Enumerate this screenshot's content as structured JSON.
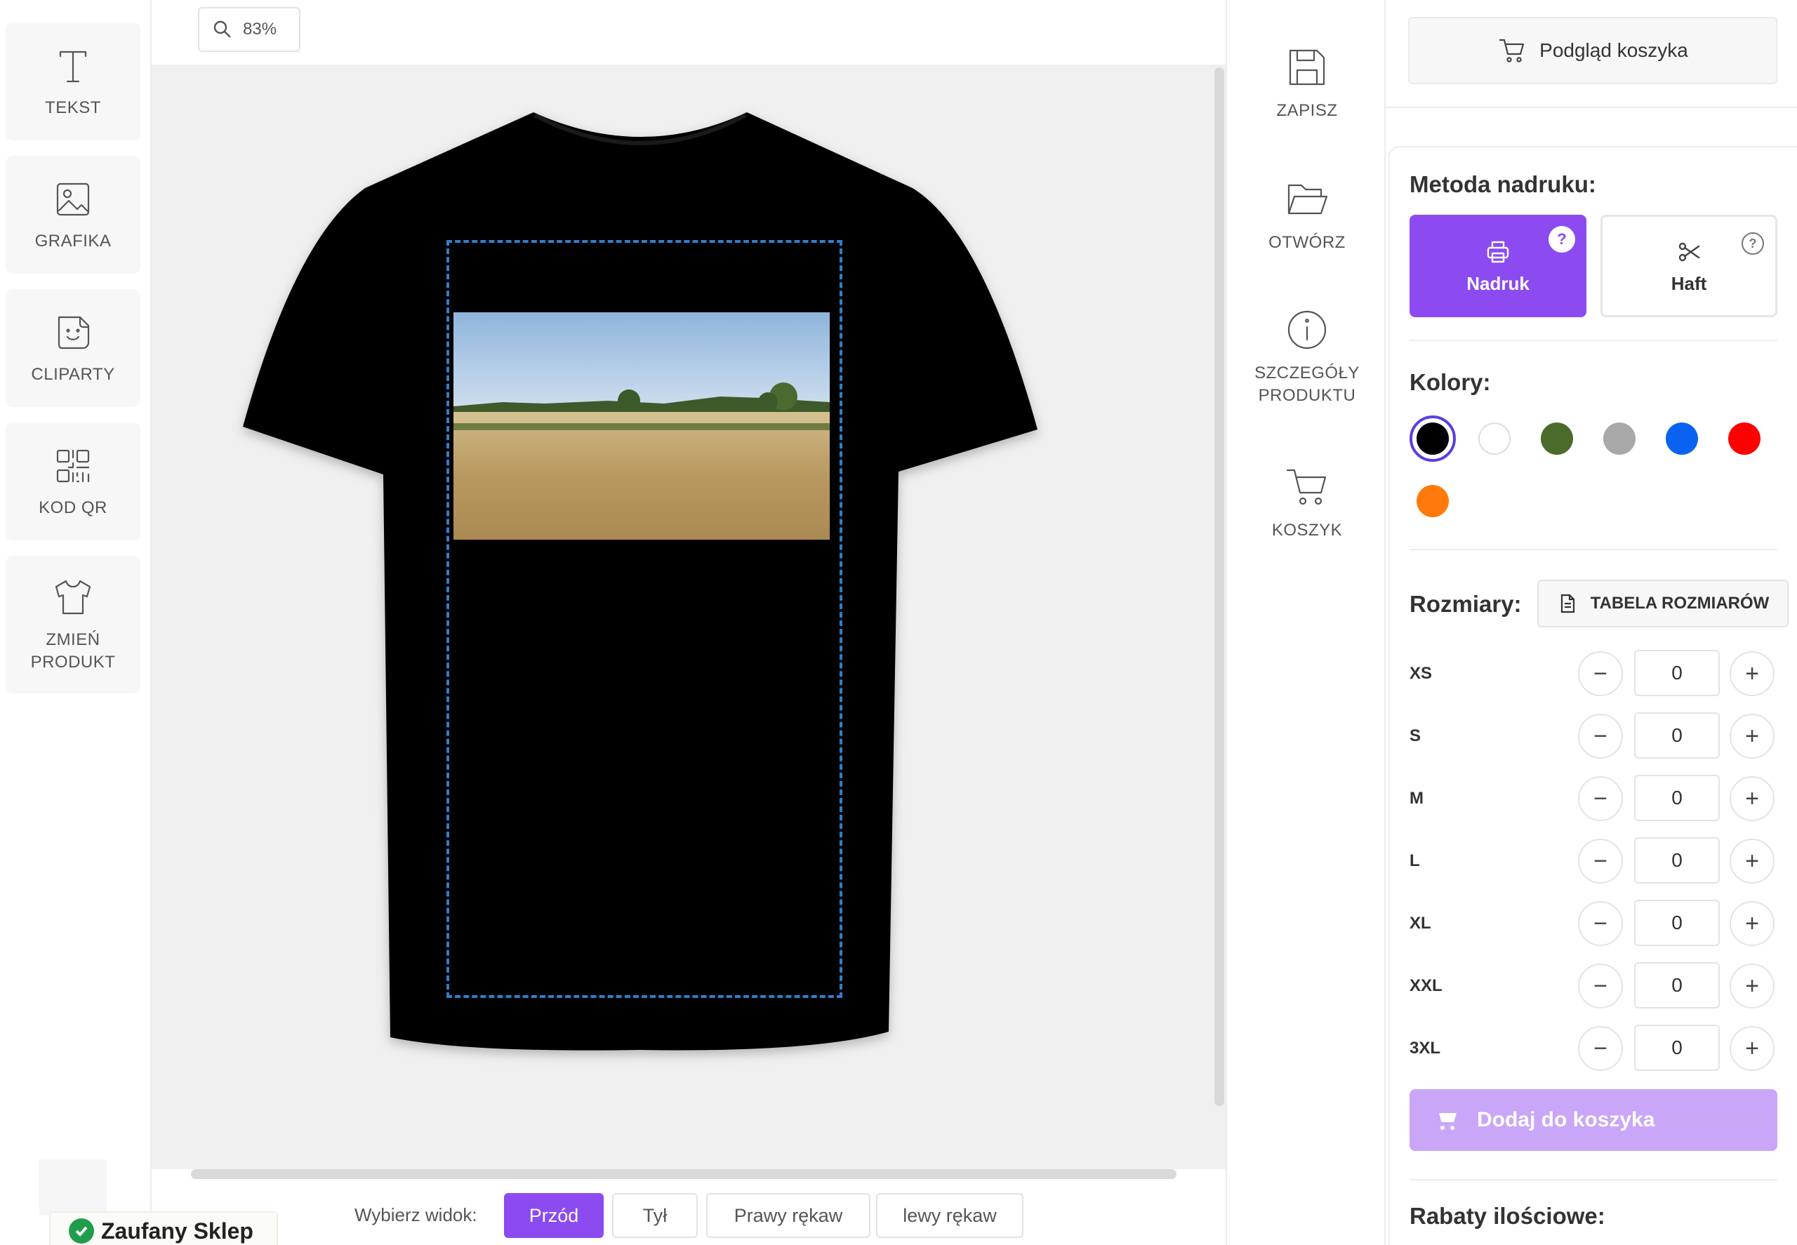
{
  "tools": [
    {
      "id": "tekst",
      "label": "TEKST",
      "icon": "text-icon"
    },
    {
      "id": "grafika",
      "label": "GRAFIKA",
      "icon": "image-icon"
    },
    {
      "id": "cliparty",
      "label": "CLIPARTY",
      "icon": "sticker-icon"
    },
    {
      "id": "kod-qr",
      "label": "KOD QR",
      "icon": "qr-code-icon"
    },
    {
      "id": "zmien-produkt",
      "label": "ZMIEŃ PRODUKT",
      "icon": "tshirt-icon"
    }
  ],
  "zoom": {
    "value": "83%",
    "icon": "search-icon"
  },
  "views": {
    "label": "Wybierz widok:",
    "options": [
      "Przód",
      "Tył",
      "Prawy rękaw",
      "lewy rękaw"
    ],
    "selected": "Przód"
  },
  "trust_badge": {
    "label": "Zaufany Sklep",
    "color": "#1e9e4a"
  },
  "actions": [
    {
      "id": "zapisz",
      "label": "ZAPISZ",
      "icon": "save-icon"
    },
    {
      "id": "otworz",
      "label": "OTWÓRZ",
      "icon": "folder-open-icon"
    },
    {
      "id": "szczegoly",
      "label": "SZCZEGÓŁY PRODUKTU",
      "icon": "info-icon"
    },
    {
      "id": "koszyk",
      "label": "KOSZYK",
      "icon": "cart-icon"
    }
  ],
  "cart_preview": {
    "label": "Podgląd koszyka",
    "icon": "cart-icon"
  },
  "print_method": {
    "heading": "Metoda nadruku:",
    "options": [
      {
        "label": "Nadruk",
        "icon": "printer-icon",
        "selected": true
      },
      {
        "label": "Haft",
        "icon": "scissors-icon",
        "selected": false
      }
    ]
  },
  "colors": {
    "heading": "Kolory:",
    "swatches": [
      "#000000",
      "#ffffff",
      "#4a6b2a",
      "#a8a8a8",
      "#0a63f0",
      "#ff0000",
      "#ff7a0a"
    ],
    "selected": "#000000"
  },
  "sizes": {
    "heading": "Rozmiary:",
    "size_table_label": "TABELA ROZMIARÓW",
    "rows": [
      {
        "size": "XS",
        "qty": "0"
      },
      {
        "size": "S",
        "qty": "0"
      },
      {
        "size": "M",
        "qty": "0"
      },
      {
        "size": "L",
        "qty": "0"
      },
      {
        "size": "XL",
        "qty": "0"
      },
      {
        "size": "XXL",
        "qty": "0"
      },
      {
        "size": "3XL",
        "qty": "0"
      }
    ],
    "minus": "−",
    "plus": "+"
  },
  "add_to_cart": {
    "label": "Dodaj do koszyka",
    "icon": "cart-icon"
  },
  "discounts": {
    "heading": "Rabaty ilościowe:"
  },
  "accent_color": "#8b4bf1",
  "shirt_color": "#000000"
}
